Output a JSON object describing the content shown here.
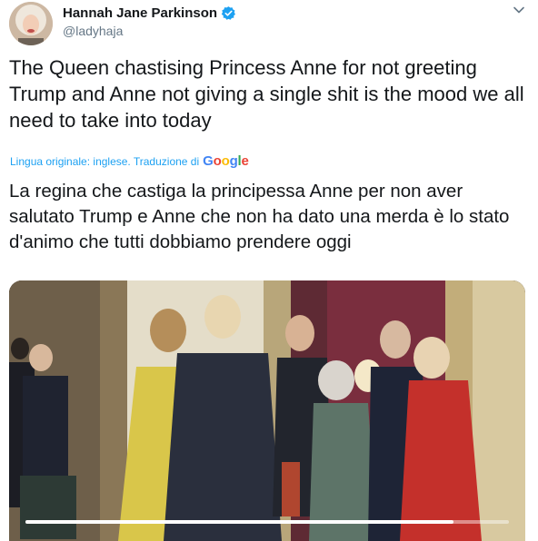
{
  "author": {
    "name": "Hannah Jane Parkinson",
    "handle": "@ladyhaja",
    "verified": true
  },
  "tweet": {
    "text": "The Queen chastising Princess Anne for not greeting Trump and Anne not giving a single shit is the mood we all need to take into today"
  },
  "translation": {
    "label": "Lingua originale: inglese. Traduzione di",
    "provider": "Google",
    "text": "La regina che castiga la principessa Anne per non aver salutato Trump e Anne che non ha dato una merda è lo stato d'animo che tutti dobbiamo prendere oggi"
  },
  "video": {
    "progress": 0.885
  },
  "colors": {
    "accent": "#1da1f2",
    "secondary_text": "#657786"
  },
  "icons": {
    "verified": "verified-badge-icon",
    "menu": "chevron-down-icon"
  }
}
